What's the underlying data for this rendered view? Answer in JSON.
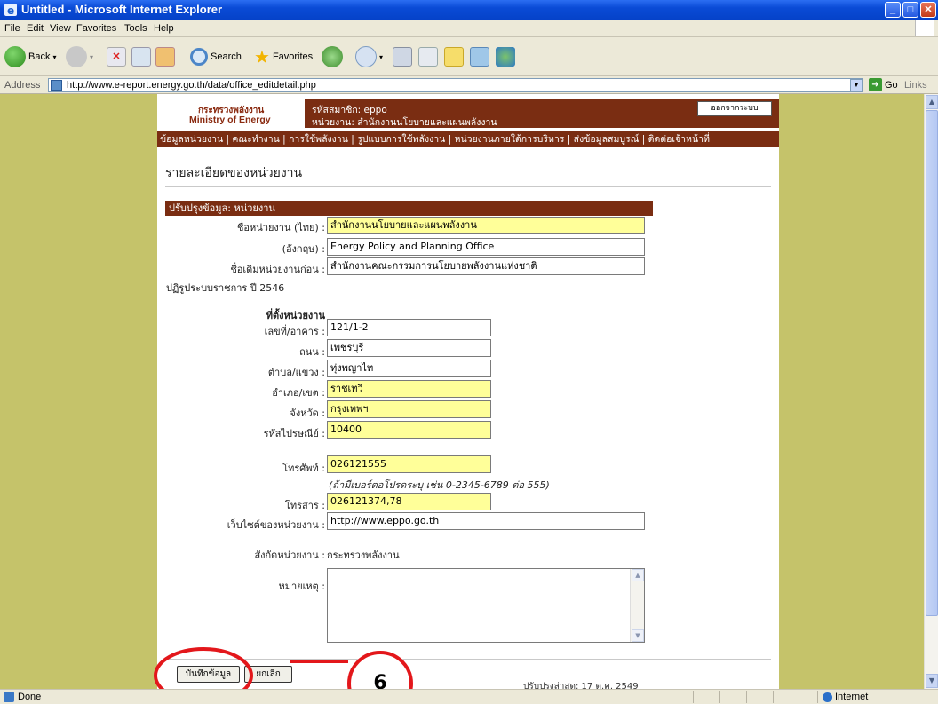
{
  "window": {
    "title": "Untitled - Microsoft Internet Explorer"
  },
  "menu": [
    "File",
    "Edit",
    "View",
    "Favorites",
    "Tools",
    "Help"
  ],
  "toolbar": {
    "back": "Back",
    "search": "Search",
    "favorites": "Favorites"
  },
  "address": {
    "label": "Address",
    "url": "http://www.e-report.energy.go.th/data/office_editdetail.php",
    "go": "Go",
    "links": "Links"
  },
  "header": {
    "logo_thai": "กระทรวงพลังงาน",
    "logo_en": "Ministry of Energy",
    "member_line": "รหัสสมาชิก: eppo",
    "agency_line": "หน่วยงาน: สำนักงานนโยบายและแผนพลังงาน",
    "logout": "ออกจากระบบ"
  },
  "nav": "ข้อมูลหน่วยงาน | คณะทำงาน | การใช้พลังงาน | รูปแบบการใช้พลังงาน | หน่วยงานภายใต้การบริหาร | ส่งข้อมูลสมบูรณ์ | ติดต่อเจ้าหน้าที่",
  "page_title": "รายละเอียดของหน่วยงาน",
  "section_title": "ปรับปรุงข้อมูล: หน่วยงาน",
  "form": {
    "name_th_label": "ชื่อหน่วยงาน (ไทย) :",
    "name_th_value": "สำนักงานนโยบายและแผนพลังงาน",
    "name_en_label": "(อังกฤษ) :",
    "name_en_value": "Energy Policy and Planning Office",
    "old_name_label": "ชื่อเดิมหน่วยงานก่อน :",
    "old_name_value": "สำนักงานคณะกรรมการนโยบายพลังงานแห่งชาติ",
    "reform_label": "ปฏิรูประบบราชการ ปี 2546",
    "location_heading": "ที่ตั้งหน่วยงาน",
    "house_label": "เลขที่/อาคาร :",
    "house_value": "121/1-2",
    "road_label": "ถนน :",
    "road_value": "เพชรบุรี",
    "subdistrict_label": "ตำบล/แขวง :",
    "subdistrict_value": "ทุ่งพญาไท",
    "district_label": "อำเภอ/เขต :",
    "district_value": "ราชเทวี",
    "province_label": "จังหวัด :",
    "province_value": "กรุงเทพฯ",
    "postcode_label": "รหัสไปรษณีย์ :",
    "postcode_value": "10400",
    "phone_label": "โทรศัพท์ :",
    "phone_value": "026121555",
    "phone_hint": "(ถ้ามีเบอร์ต่อโปรดระบุ เช่น 0-2345-6789 ต่อ 555)",
    "fax_label": "โทรสาร :",
    "fax_value": "026121374,78",
    "web_label": "เว็บไซต์ของหน่วยงาน :",
    "web_value": "http://www.eppo.go.th",
    "affiliation_label": "สังกัดหน่วยงาน :",
    "affiliation_value": "กระทรวงพลังงาน",
    "remark_label": "หมายเหตุ :",
    "remark_value": ""
  },
  "buttons": {
    "save": "บันทึกข้อมูล",
    "cancel": "ยกเลิก"
  },
  "footer_date": "ปรับปรุงล่าสุด: 17 ต.ค. 2549",
  "callout": "6",
  "status": {
    "left": "Done",
    "zone": "Internet"
  },
  "colors": {
    "accent": "#7a2d12",
    "highlight_field": "#ffff99",
    "callout": "#e3171b",
    "page_bg": "#c5c36a"
  }
}
